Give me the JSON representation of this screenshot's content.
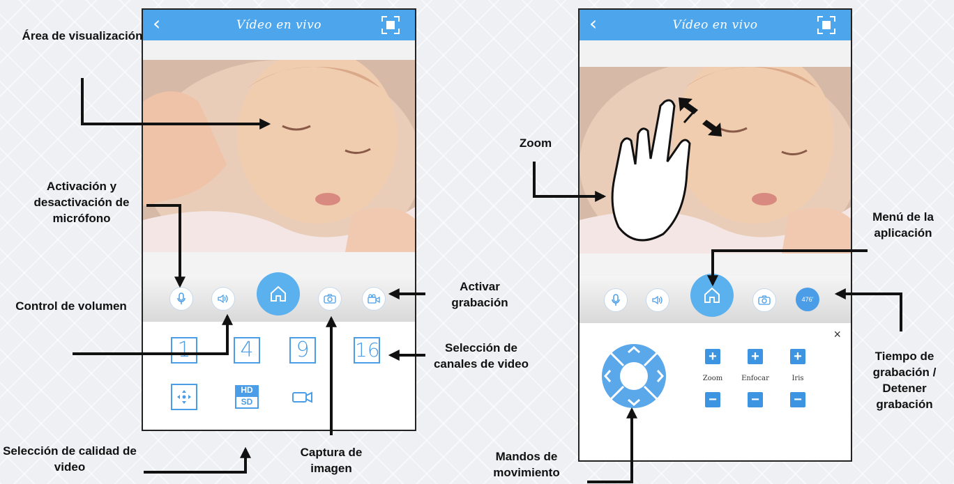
{
  "screenA": {
    "title": "Vídeo en vivo",
    "back_icon": "chevron-left",
    "channels": [
      "1",
      "4",
      "9",
      "16"
    ],
    "hd_label": "HD",
    "sd_label": "SD"
  },
  "screenB": {
    "title": "Vídeo en vivo",
    "record_time": "476'",
    "close": "×",
    "ptz": {
      "zoom_label": "Zoom",
      "focus_label": "Enfocar",
      "iris_label": "Iris",
      "plus": "+",
      "minus": "−"
    }
  },
  "annotations": {
    "area": "Área de visualización",
    "mic": "Activación y desactivación de micrófono",
    "volume": "Control de volumen",
    "quality": "Selección de calidad de video",
    "capture": "Captura de imagen",
    "record": "Activar grabación",
    "channels": "Selección de canales de video",
    "zoom": "Zoom",
    "menu": "Menú de la aplicación",
    "rectime": "Tiempo de grabación / Detener grabación",
    "ptz": "Mandos de movimiento"
  },
  "colors": {
    "accent": "#4da6ec",
    "button_blue": "#3d95e2",
    "arrow": "#111111"
  }
}
